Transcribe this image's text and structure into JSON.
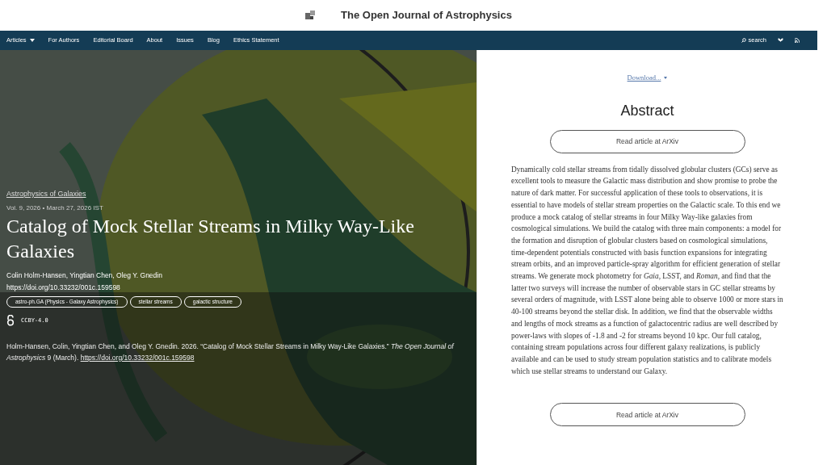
{
  "header": {
    "title": "The Open Journal of Astrophysics"
  },
  "nav": {
    "items": [
      {
        "label": "Articles",
        "dropdown": true
      },
      {
        "label": "For Authors",
        "dropdown": false
      },
      {
        "label": "Editorial Board",
        "dropdown": false
      },
      {
        "label": "About",
        "dropdown": false
      },
      {
        "label": "Issues",
        "dropdown": false
      },
      {
        "label": "Blog",
        "dropdown": false
      },
      {
        "label": "Ethics Statement",
        "dropdown": false
      }
    ],
    "search": "search"
  },
  "hero": {
    "category": "Astrophysics of Galaxies",
    "meta": "Vol. 9, 2026 • March 27, 2026 IST",
    "title": "Catalog of Mock Stellar Streams in Milky Way-Like Galaxies",
    "authors": "Colin Holm-Hansen, Yingtian Chen, Oleg Y. Gnedin",
    "doi": "https://doi.org/10.33232/001c.159598",
    "tags": [
      "astro-ph.GA (Physics - Galaxy Astrophysics)",
      "stellar streams",
      "galactic structure"
    ],
    "license": "CCBY-4.0",
    "citation": "Holm-Hansen, Colin, Yingtian Chen, and Oleg Y. Gnedin. 2026. “Catalog of Mock Stellar Streams in Milky Way-Like Galaxies.” *The Open Journal of Astrophysics* 9 (March).",
    "citation_link": "https://doi.org/10.33232/001c.159598"
  },
  "panel": {
    "download": "Download...",
    "heading": "Abstract",
    "buttons": [
      "Read article at ArXiv",
      "Read article at ArXiv"
    ],
    "abstract": "Dynamically cold stellar streams from tidally dissolved globular clusters (GCs) serve as excellent tools to measure the Galactic mass distribution and show promise to probe the nature of dark matter. For successful application of these tools to observations, it is essential to have models of stellar stream properties on the Galactic scale. To this end we produce a mock catalog of stellar streams in four Milky Way-like galaxies from cosmological simulations. We build the catalog with three main components: a model for the formation and disruption of globular clusters based on cosmological simulations, time-dependent potentials constructed with basis function expansions for integrating stream orbits, and an improved particle-spray algorithm for efficient generation of stellar streams. We generate mock photometry for *Gaia*, LSST, and *Roman*, and find that the latter two surveys will increase the number of observable stars in GC stellar streams by several orders of magnitude, with LSST alone being able to observe 1000 or more stars in 40-100 streams beyond the stellar disk. In addition, we find that the observable widths and lengths of mock streams as a function of galactocentric radius are well described by power-laws with slopes of -1.8 and -2 for streams beyond 10 kpc. Our full catalog, containing stream populations across four different galaxy realizations, is publicly available and can be used to study stream population statistics and to calibrate models which use stellar streams to understand our Galaxy."
  }
}
